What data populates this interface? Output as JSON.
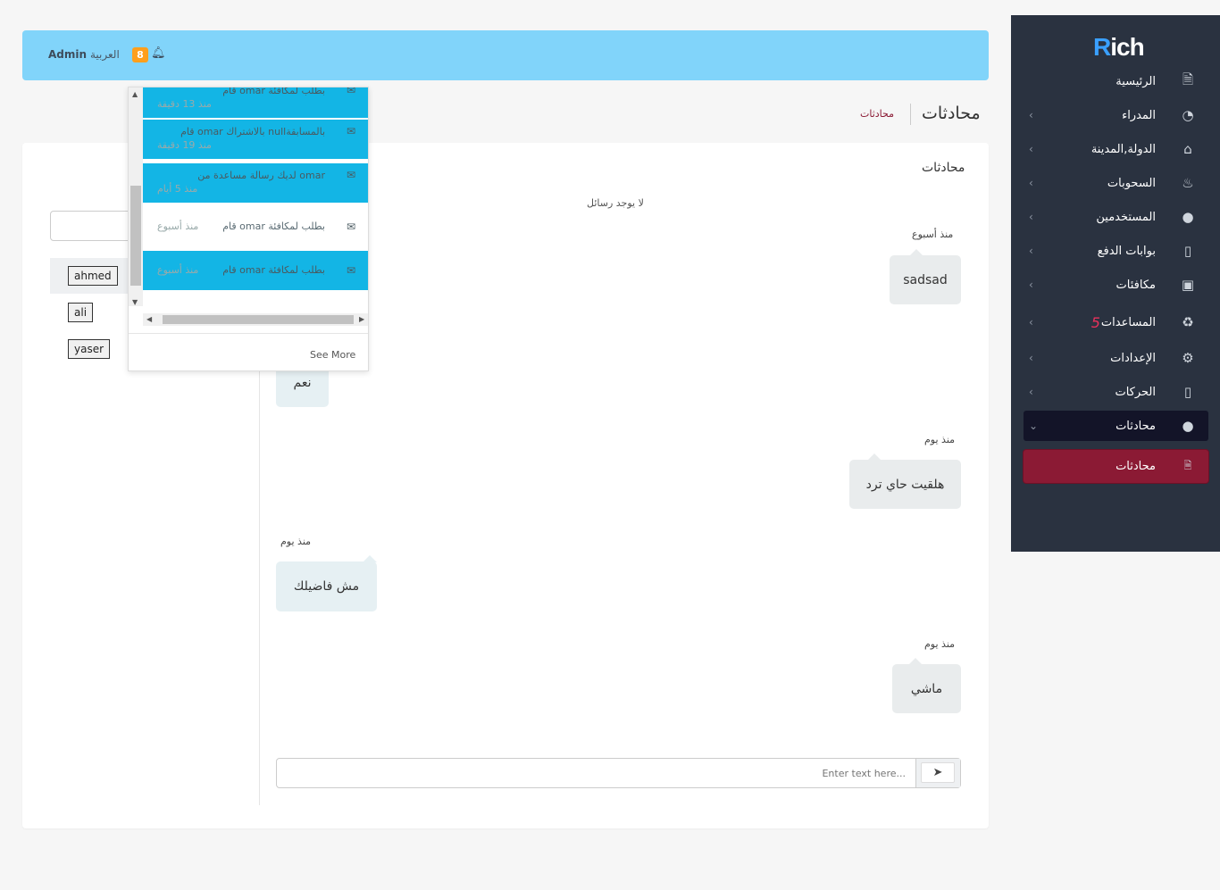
{
  "brand": {
    "logo_prefix": "R",
    "logo_rest": "ich"
  },
  "topbar": {
    "admin": "Admin",
    "language": "العربية",
    "notification_count": "8"
  },
  "page": {
    "title": "محادثات",
    "breadcrumb": "محادثات"
  },
  "sidebar": {
    "items": [
      {
        "label": "الرئيسية",
        "icon": "document-icon"
      },
      {
        "label": "المدراء",
        "icon": "pie-chart-icon"
      },
      {
        "label": "الدولة,المدينة",
        "icon": "home-icon"
      },
      {
        "label": "السحوبات",
        "icon": "fire-icon"
      },
      {
        "label": "المستخدمين",
        "icon": "user-icon"
      },
      {
        "label": "بوابات الدفع",
        "icon": "card-icon"
      },
      {
        "label": "مكافئات",
        "icon": "gift-icon"
      },
      {
        "label": "المساعدات",
        "badge": "5",
        "icon": "recycle-icon"
      },
      {
        "label": "الإعدادات",
        "icon": "gear-icon"
      },
      {
        "label": "الحركات",
        "icon": "card-icon"
      },
      {
        "label": "محادثات",
        "icon": "user-icon"
      }
    ],
    "sub_item": {
      "label": "محادثات",
      "icon": "file-icon"
    }
  },
  "chat": {
    "card_title": "محادثات",
    "no_messages": "لا يوجد رسائل",
    "users": [
      "ahmed",
      "ali",
      "yaser"
    ],
    "messages": [
      {
        "time": "منذ أسبوع",
        "text": "sadsad",
        "side": "right"
      },
      {
        "time": "",
        "text": "نعم",
        "side": "left"
      },
      {
        "time": "منذ يوم",
        "text": "هلقيت حاي ترد",
        "side": "right"
      },
      {
        "time": "منذ يوم",
        "text": "مش فاضيلك",
        "side": "left"
      },
      {
        "time": "منذ يوم",
        "text": "ماشي",
        "side": "right"
      }
    ],
    "composer_placeholder": "Enter text here..."
  },
  "notifications": {
    "items": [
      {
        "text": "قام omar بطلب لمكافئة",
        "time": "منذ 13 دقيقة",
        "highlighted": true
      },
      {
        "text": "قام omar بالاشتراك nullبالمسابقة",
        "time": "منذ 19 دقيقة",
        "highlighted": true
      },
      {
        "text": "لديك رسالة مساعدة من omar",
        "time": "منذ 5 أيام",
        "highlighted": true
      },
      {
        "text": "قام omar بطلب لمكافئة",
        "time": "منذ أسبوع",
        "highlighted": false
      },
      {
        "text": "قام omar بطلب لمكافئة",
        "time": "منذ أسبوع",
        "highlighted": true
      }
    ],
    "see_more": "See More"
  },
  "colors": {
    "sidebar_bg": "#2a3240",
    "topbar_bg": "#81d4fa",
    "active_sub": "#8b1a34",
    "notif_highlight": "#13b5e5",
    "badge": "#ff9f1c"
  }
}
